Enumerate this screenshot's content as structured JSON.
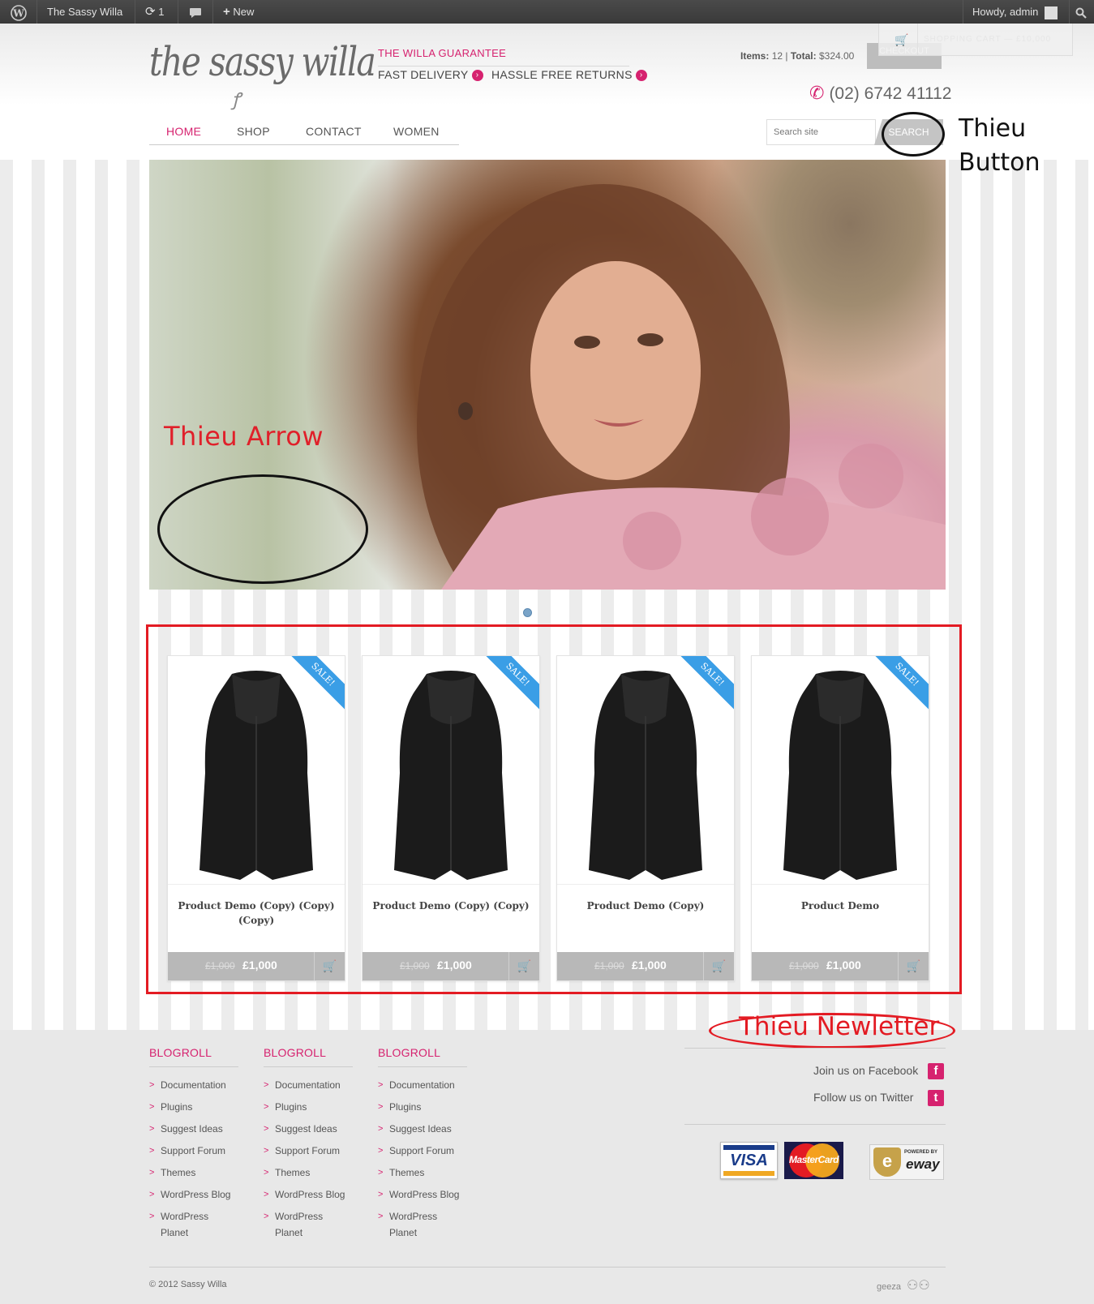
{
  "adminbar": {
    "site_name": "The Sassy Willa",
    "updates_count": "1",
    "new_label": "New",
    "greeting": "Howdy, admin"
  },
  "header": {
    "logo_text": "the sassy willa",
    "guarantee_title": "THE WILLA GUARANTEE",
    "guarantee_items": [
      "FAST DELIVERY",
      "HASSLE FREE RETURNS"
    ],
    "cart_items_label": "Items:",
    "cart_items_count": "12",
    "cart_total_label": "Total:",
    "cart_total": "$324.00",
    "checkout_label": "CHECKOUT",
    "shopping_cart_label": "SHOPPING CART — £10,000",
    "phone": "(02) 6742 41112",
    "nav": [
      "HOME",
      "SHOP",
      "CONTACT",
      "WOMEN"
    ],
    "search_placeholder": "Search site",
    "search_button": "SEARCH"
  },
  "annotations": {
    "button_note_line1": "Thieu",
    "button_note_line2": "Button",
    "arrow_note": "Thieu Arrow",
    "newsletter_note": "Thieu Newletter"
  },
  "products": [
    {
      "name": "Product Demo (Copy) (Copy) (Copy)",
      "old_price": "£1,000",
      "price": "£1,000",
      "badge": "SALE!"
    },
    {
      "name": "Product Demo (Copy) (Copy)",
      "old_price": "£1,000",
      "price": "£1,000",
      "badge": "SALE!"
    },
    {
      "name": "Product Demo (Copy)",
      "old_price": "£1,000",
      "price": "£1,000",
      "badge": "SALE!"
    },
    {
      "name": "Product Demo",
      "old_price": "£1,000",
      "price": "£1,000",
      "badge": "SALE!"
    }
  ],
  "footer": {
    "columns": [
      {
        "title": "BLOGROLL",
        "links": [
          "Documentation",
          "Plugins",
          "Suggest Ideas",
          "Support Forum",
          "Themes",
          "WordPress Blog",
          "WordPress Planet"
        ]
      },
      {
        "title": "BLOGROLL",
        "links": [
          "Documentation",
          "Plugins",
          "Suggest Ideas",
          "Support Forum",
          "Themes",
          "WordPress Blog",
          "WordPress Planet"
        ]
      },
      {
        "title": "BLOGROLL",
        "links": [
          "Documentation",
          "Plugins",
          "Suggest Ideas",
          "Support Forum",
          "Themes",
          "WordPress Blog",
          "WordPress Planet"
        ]
      }
    ],
    "facebook": "Join us on Facebook",
    "twitter": "Follow us on Twitter",
    "visa": "VISA",
    "mastercard": "MasterCard",
    "eway_small": "POWERED BY",
    "eway_brand": "eway",
    "copyright": "© 2012 Sassy Willa",
    "credit": "geeza"
  },
  "colors": {
    "accent": "#d6226f",
    "sale_badge": "#3a9ee6",
    "annotation_red": "#e31b23"
  }
}
